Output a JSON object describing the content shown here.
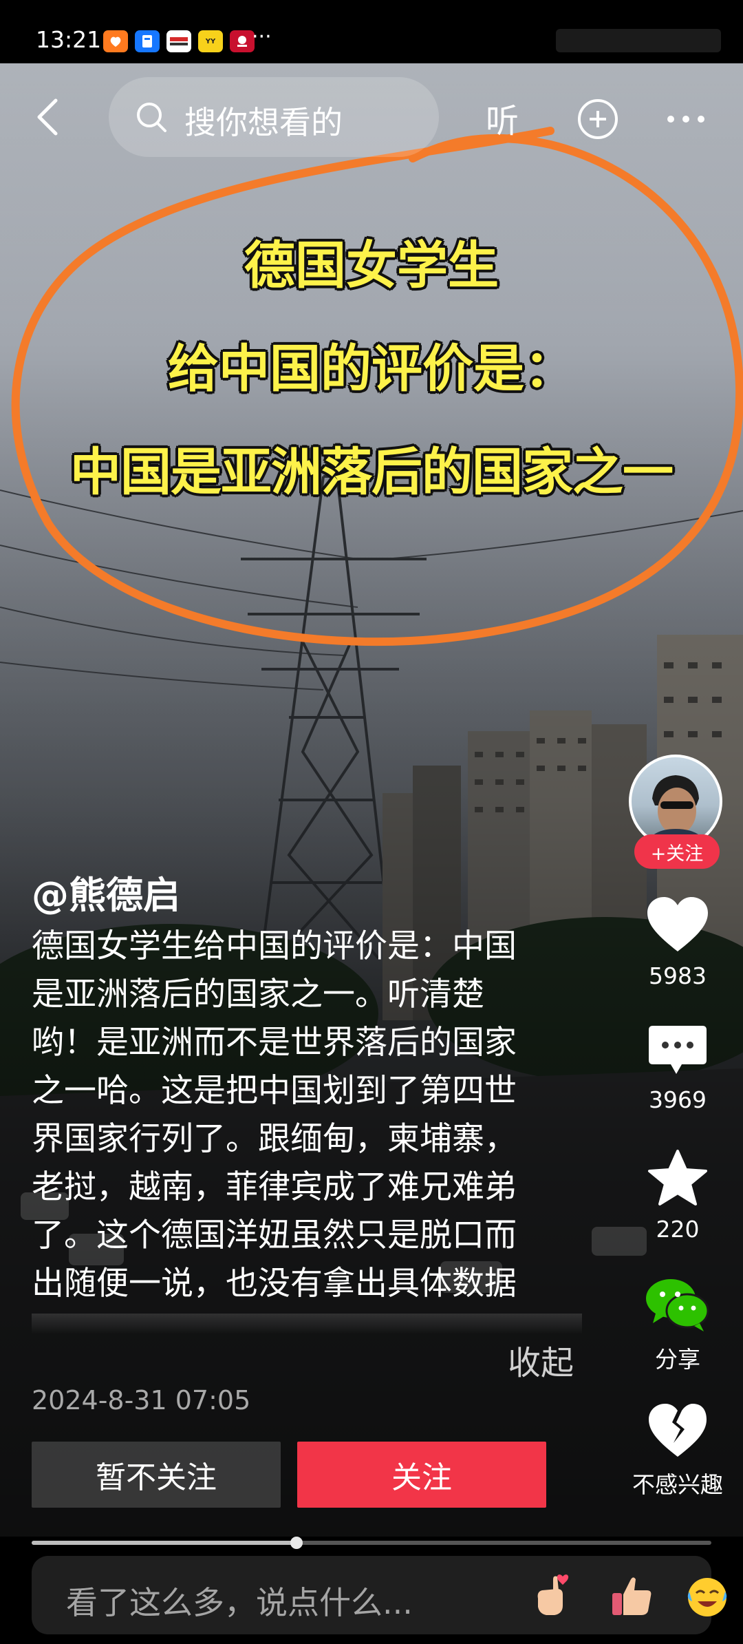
{
  "status_bar": {
    "time": "13:21",
    "app_icons": [
      {
        "name": "taobao-icon",
        "color": "#ff7a1f",
        "text": ""
      },
      {
        "name": "alipay-icon",
        "color": "#1677ff",
        "text": ""
      },
      {
        "name": "news-app-icon",
        "color": "#d62a2a",
        "text": ""
      },
      {
        "name": "yy-icon",
        "color": "#f7d11b",
        "text": "YY"
      },
      {
        "name": "bank-app-icon",
        "color": "#c8102e",
        "text": ""
      }
    ],
    "more": "···"
  },
  "header": {
    "search_placeholder": "搜你想看的",
    "listen_label": "听"
  },
  "overlay_text": {
    "line1": "德国女学生",
    "line2": "给中国的评价是：",
    "line3": "中国是亚洲落后的国家之一"
  },
  "author": {
    "handle": "@熊德启",
    "follow_pill": "+关注"
  },
  "caption": {
    "lines": [
      "德国女学生给中国的评价是：中国",
      "是亚洲落后的国家之一。听清楚",
      "哟！是亚洲而不是世界落后的国家",
      "之一哈。这是把中国划到了第四世",
      "界国家行列了。跟缅甸，柬埔寨，",
      "老挝，越南，菲律宾成了难兄难弟",
      "了。这个德国洋妞虽然只是脱口而",
      "出随便一说，也没有拿出具体数据"
    ],
    "collapse": "收起",
    "date": "2024-8-31 07:05"
  },
  "rail": {
    "likes": "5983",
    "comments": "3969",
    "favorites": "220",
    "share_label": "分享",
    "dislike_label": "不感兴趣"
  },
  "actions": {
    "unfollow": "暂不关注",
    "follow": "关注"
  },
  "playback": {
    "progress": 0.39
  },
  "comment_bar": {
    "placeholder": "看了这么多，说点什么..."
  },
  "colors": {
    "accent_red": "#f23548",
    "headline_yellow": "#fdf24a",
    "scribble_orange": "#f47b2a",
    "wechat_green": "#2dc100"
  }
}
